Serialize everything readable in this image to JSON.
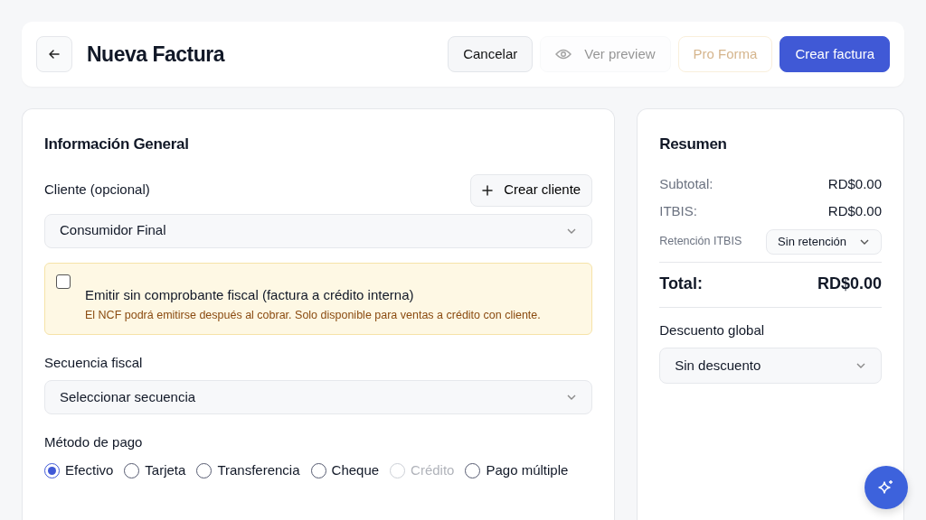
{
  "header": {
    "title": "Nueva Factura",
    "buttons": [
      {
        "label": "Cancelar",
        "kind": "secondary",
        "disabled": false
      },
      {
        "label": "Ver preview",
        "kind": "preview",
        "disabled": true
      },
      {
        "label": "Pro Forma",
        "kind": "proforma",
        "disabled": true
      },
      {
        "label": "Crear factura",
        "kind": "primary",
        "disabled": false
      }
    ]
  },
  "general": {
    "title": "Información General",
    "client_label": "Cliente (opcional)",
    "create_client_button": "Crear cliente",
    "client_select": "Consumidor Final",
    "notice": {
      "checked": false,
      "label": "Emitir sin comprobante fiscal (factura a crédito interna)",
      "note": "El NCF podrá emitirse después al cobrar. Solo disponible para ventas a crédito con cliente."
    },
    "sequence_label": "Secuencia fiscal",
    "sequence_select": "Seleccionar secuencia",
    "payment_label": "Método de pago",
    "payment_methods": [
      {
        "label": "Efectivo",
        "selected": true,
        "disabled": false
      },
      {
        "label": "Tarjeta",
        "selected": false,
        "disabled": false
      },
      {
        "label": "Transferencia",
        "selected": false,
        "disabled": false
      },
      {
        "label": "Cheque",
        "selected": false,
        "disabled": false
      },
      {
        "label": "Crédito",
        "selected": false,
        "disabled": true
      },
      {
        "label": "Pago múltiple",
        "selected": false,
        "disabled": false
      }
    ]
  },
  "summary": {
    "title": "Resumen",
    "rows": [
      {
        "label": "Subtotal:",
        "value": "RD$0.00"
      },
      {
        "label": "ITBIS:",
        "value": "RD$0.00"
      }
    ],
    "retention": {
      "label": "Retención ITBIS",
      "value": "Sin retención"
    },
    "total": {
      "label": "Total:",
      "value": "RD$0.00"
    },
    "discount": {
      "label": "Descuento global",
      "value": "Sin descuento"
    }
  }
}
